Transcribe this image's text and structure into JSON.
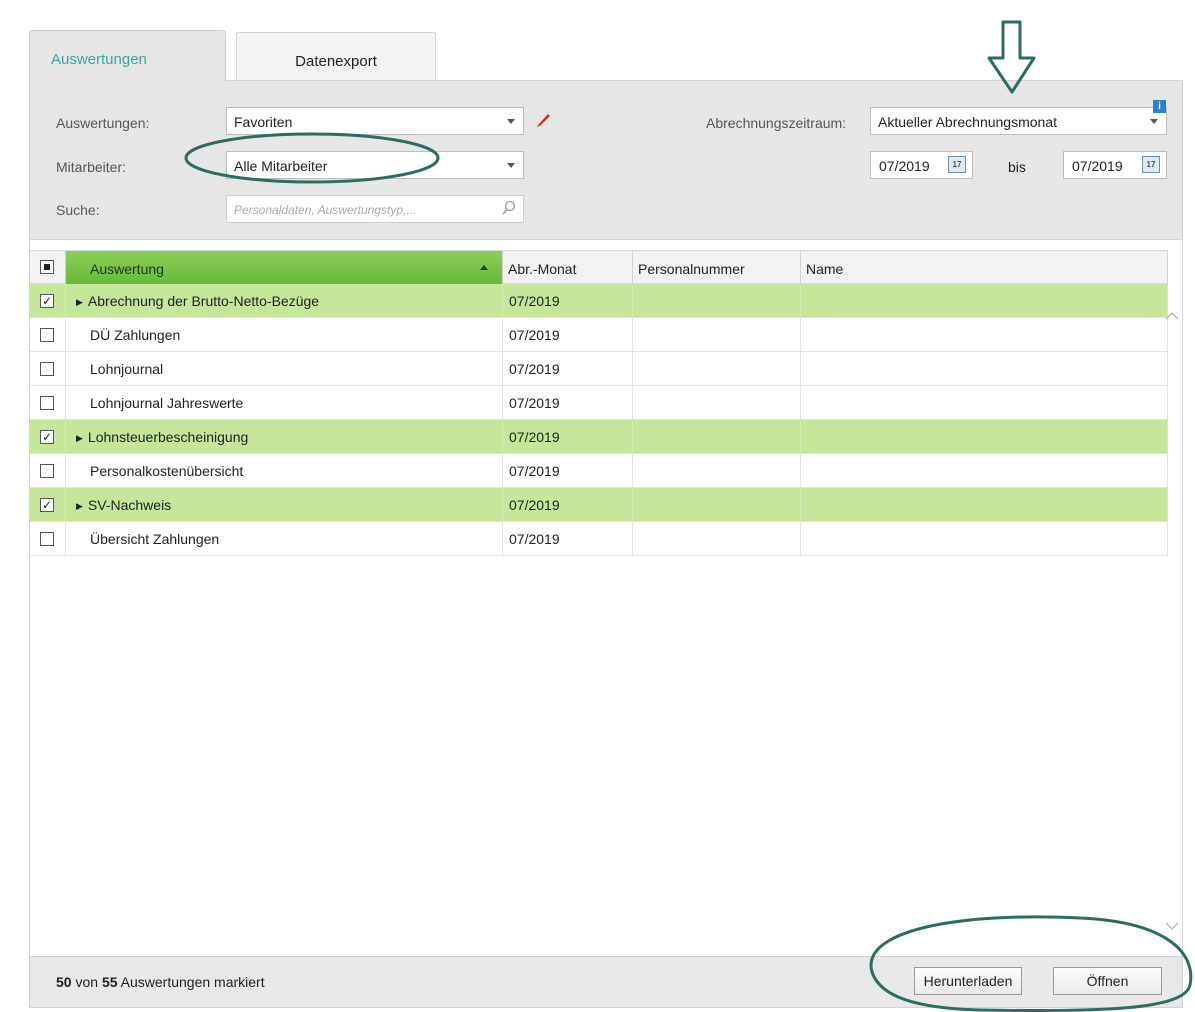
{
  "tabs": [
    {
      "label": "Auswertungen",
      "active": true
    },
    {
      "label": "Datenexport",
      "active": false
    }
  ],
  "filters": {
    "auswertungen_label": "Auswertungen:",
    "auswertungen_value": "Favoriten",
    "mitarbeiter_label": "Mitarbeiter:",
    "mitarbeiter_value": "Alle Mitarbeiter",
    "suche_label": "Suche:",
    "suche_placeholder": "Personaldaten, Auswertungstyp,...",
    "zeitraum_label": "Abrechnungszeitraum:",
    "zeitraum_value": "Aktueller Abrechnungsmonat",
    "from_date": "07/2019",
    "bis_label": "bis",
    "to_date": "07/2019",
    "calendar_icon_text": "17",
    "info_badge": "i"
  },
  "grid": {
    "columns": [
      "Auswertung",
      "Abr.-Monat",
      "Personalnummer",
      "Name"
    ],
    "rows": [
      {
        "name": "Abrechnung der Brutto-Netto-Bezüge",
        "month": "07/2019",
        "checked": true,
        "expandable": true,
        "check_glyph": "✓"
      },
      {
        "name": "DÜ Zahlungen",
        "month": "07/2019",
        "checked": false,
        "expandable": false,
        "check_glyph": ""
      },
      {
        "name": "Lohnjournal",
        "month": "07/2019",
        "checked": false,
        "expandable": false,
        "check_glyph": ""
      },
      {
        "name": "Lohnjournal Jahreswerte",
        "month": "07/2019",
        "checked": false,
        "expandable": false,
        "check_glyph": ""
      },
      {
        "name": "Lohnsteuerbescheinigung",
        "month": "07/2019",
        "checked": true,
        "expandable": true,
        "check_glyph": "✓"
      },
      {
        "name": "Personalkostenübersicht",
        "month": "07/2019",
        "checked": false,
        "expandable": false,
        "check_glyph": ""
      },
      {
        "name": "SV-Nachweis",
        "month": "07/2019",
        "checked": true,
        "expandable": true,
        "check_glyph": "✓"
      },
      {
        "name": "Übersicht Zahlungen",
        "month": "07/2019",
        "checked": false,
        "expandable": false,
        "check_glyph": ""
      }
    ]
  },
  "footer": {
    "marked_count": "50",
    "von_text": "von",
    "total_count": "55",
    "suffix_text": "Auswertungen markiert",
    "download_label": "Herunterladen",
    "open_label": "Öffnen"
  },
  "colors": {
    "accent_tab": "#3aa6a0",
    "checked_row": "#c6e79a",
    "sorted_header": "#7cc54b",
    "annotation": "#2d6b63",
    "pencil": "#c0392b"
  },
  "icons": {
    "pencil": "pencil-icon",
    "search": "search-icon",
    "calendar": "calendar-icon",
    "info": "info-icon",
    "dropdown": "chevron-down-icon",
    "sort": "sort-ascending-icon",
    "expand": "expand-triangle-icon",
    "scroll_up": "chevron-up-icon",
    "scroll_down": "chevron-down-icon"
  }
}
